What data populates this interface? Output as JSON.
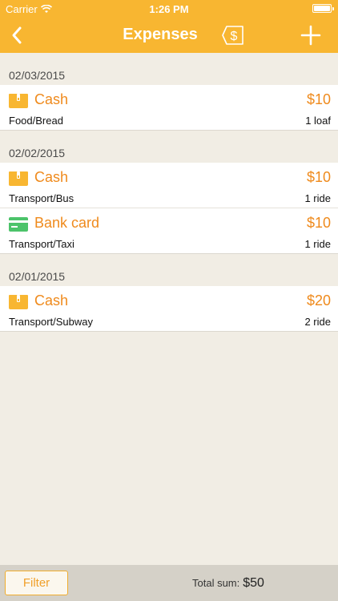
{
  "status_bar": {
    "carrier": "Carrier",
    "time": "1:26 PM"
  },
  "nav": {
    "title": "Expenses",
    "back_icon": "chevron-left-icon",
    "currency_icon": "dollar-tag-icon",
    "add_icon": "plus-icon"
  },
  "colors": {
    "header": "#f8b631",
    "accent": "#ef8a1c",
    "cash_icon": "#f8b631",
    "card_icon": "#4cc36a"
  },
  "groups": [
    {
      "date": "02/03/2015",
      "entries": [
        {
          "method": "Cash",
          "icon": "wallet-icon",
          "amount": "$10",
          "category": "Food/Bread",
          "qty": "1 loaf"
        }
      ]
    },
    {
      "date": "02/02/2015",
      "entries": [
        {
          "method": "Cash",
          "icon": "wallet-icon",
          "amount": "$10",
          "category": "Transport/Bus",
          "qty": "1 ride"
        },
        {
          "method": "Bank card",
          "icon": "credit-card-icon",
          "amount": "$10",
          "category": "Transport/Taxi",
          "qty": "1 ride"
        }
      ]
    },
    {
      "date": "02/01/2015",
      "entries": [
        {
          "method": "Cash",
          "icon": "wallet-icon",
          "amount": "$20",
          "category": "Transport/Subway",
          "qty": "2 ride"
        }
      ]
    }
  ],
  "footer": {
    "filter_label": "Filter",
    "total_label": "Total sum:",
    "total_value": "$50"
  }
}
